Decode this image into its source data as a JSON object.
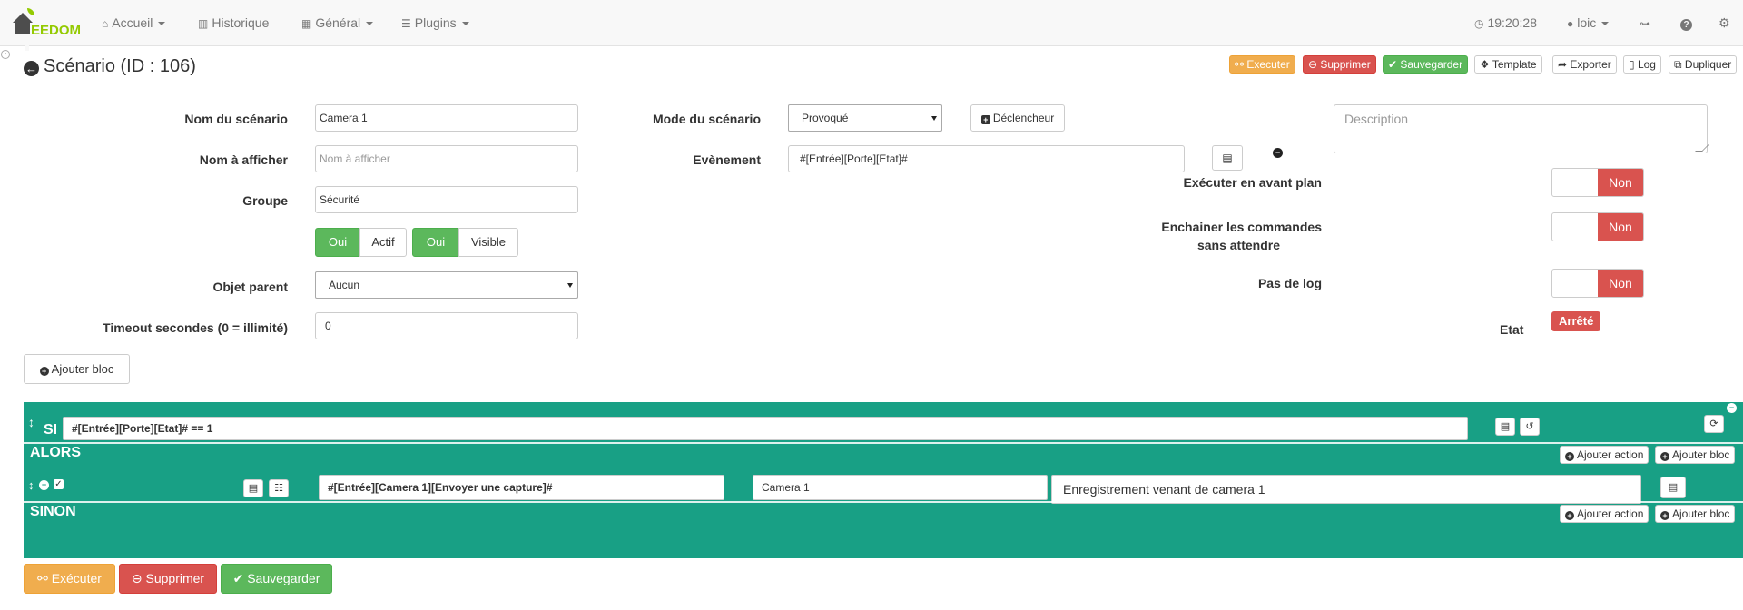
{
  "nav": {
    "brand": "EEDOM",
    "items": [
      {
        "icon": "home-icon",
        "glyph": "⌂",
        "label": "Accueil",
        "dropdown": true
      },
      {
        "icon": "bar-chart-icon",
        "glyph": "▥",
        "label": "Historique",
        "dropdown": false
      },
      {
        "icon": "grid-icon",
        "glyph": "▦",
        "label": "Général",
        "dropdown": true
      },
      {
        "icon": "list-icon",
        "glyph": "☰",
        "label": "Plugins",
        "dropdown": true
      }
    ],
    "clock": "19:20:28",
    "user": "loic"
  },
  "page": {
    "title": "Scénario (ID : 106)"
  },
  "toolbar": {
    "execute": "Executer",
    "delete": "Supprimer",
    "save": "Sauvegarder",
    "template": "Template",
    "export": "Exporter",
    "log": "Log",
    "duplicate": "Dupliquer"
  },
  "form": {
    "name_label": "Nom du scénario",
    "name_value": "Camera 1",
    "display_label": "Nom à afficher",
    "display_placeholder": "Nom à afficher",
    "group_label": "Groupe",
    "group_value": "Sécurité",
    "active_yes": "Oui",
    "active_label": "Actif",
    "visible_yes": "Oui",
    "visible_label": "Visible",
    "parent_label": "Objet parent",
    "parent_value": "Aucun",
    "timeout_label": "Timeout secondes (0 = illimité)",
    "timeout_value": "0",
    "mode_label": "Mode du scénario",
    "mode_value": "Provoqué",
    "trigger_button": "Déclencheur",
    "event_label": "Evènement",
    "event_value": "#[Entrée][Porte][Etat]#",
    "description_placeholder": "Description",
    "foreground_label": "Exécuter en avant plan",
    "foreground_value": "Non",
    "chain_label_1": "Enchainer les commandes",
    "chain_label_2": "sans attendre",
    "chain_value": "Non",
    "nolog_label": "Pas de log",
    "nolog_value": "Non",
    "state_label": "Etat",
    "state_value": "Arrêté",
    "add_block": "Ajouter bloc"
  },
  "block": {
    "if_label": "SI",
    "condition": "#[Entrée][Porte][Etat]# == 1",
    "then_label": "ALORS",
    "else_label": "SINON",
    "add_action": "Ajouter action",
    "add_block": "Ajouter bloc",
    "action_cmd": "#[Entrée][Camera 1][Envoyer une capture]#",
    "action_title": "Camera 1",
    "action_message": "Enregistrement venant de camera 1"
  },
  "footer": {
    "execute": "Exécuter",
    "delete": "Supprimer",
    "save": "Sauvegarder"
  },
  "colors": {
    "block_bg": "#18a085",
    "danger": "#d9534f",
    "success": "#5cb85c",
    "warning": "#f0ad4e",
    "brand": "#94ca02"
  }
}
